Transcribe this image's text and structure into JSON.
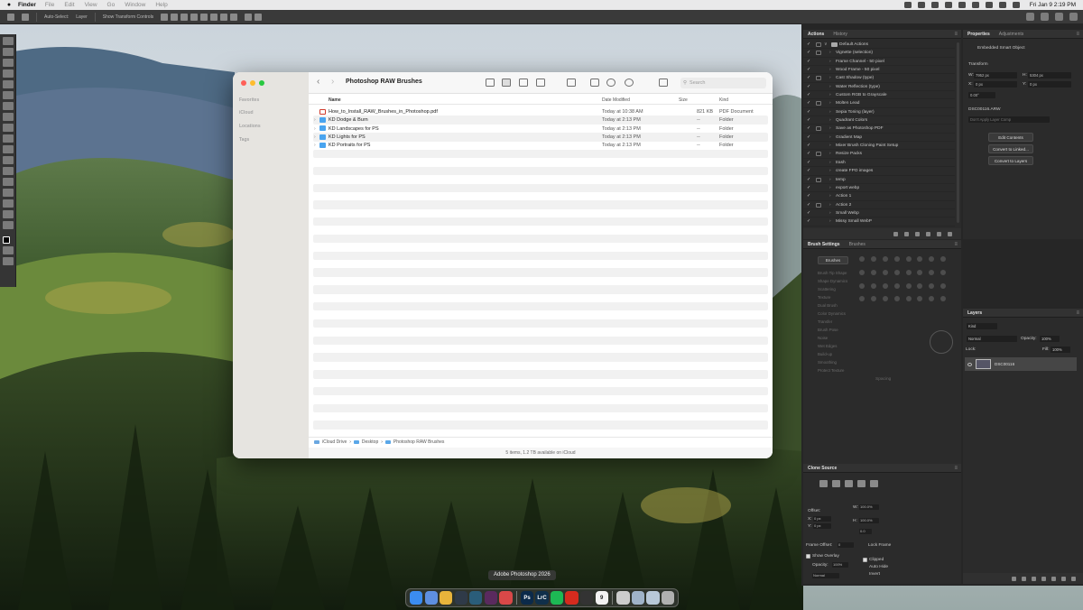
{
  "menubar": {
    "apple": "",
    "app_name": "Finder",
    "items": [
      "File",
      "Edit",
      "View",
      "Go",
      "Window",
      "Help"
    ],
    "clock": "Fri Jan 9  2:19 PM"
  },
  "options_bar": {
    "auto_select": "Auto-Select:",
    "layer_select": "Layer",
    "transform_controls": "Show Transform Controls"
  },
  "finder": {
    "title": "Photoshop RAW Brushes",
    "search_placeholder": "Search",
    "sidebar": {
      "favorites": "Favorites",
      "icloud": "iCloud",
      "locations": "Locations",
      "tags": "Tags"
    },
    "columns": {
      "name": "Name",
      "date": "Date Modified",
      "size": "Size",
      "kind": "Kind"
    },
    "rows": [
      {
        "name": "How_to_Install_RAW_Brushes_in_Photoshop.pdf",
        "date": "Today at 10:38 AM",
        "size": "821 KB",
        "kind": "PDF Document",
        "type": "pdf"
      },
      {
        "name": "KD Dodge & Burn",
        "date": "Today at 2:13 PM",
        "size": "--",
        "kind": "Folder",
        "type": "folder"
      },
      {
        "name": "KD Landscapes for PS",
        "date": "Today at 2:13 PM",
        "size": "--",
        "kind": "Folder",
        "type": "folder"
      },
      {
        "name": "KD Lights for PS",
        "date": "Today at 2:13 PM",
        "size": "--",
        "kind": "Folder",
        "type": "folder"
      },
      {
        "name": "KD Portraits for PS",
        "date": "Today at 2:13 PM",
        "size": "--",
        "kind": "Folder",
        "type": "folder"
      }
    ],
    "path": [
      "iCloud Drive",
      "Desktop",
      "Photoshop RAW Brushes"
    ],
    "status": "5 items, 1.2 TB available on iCloud"
  },
  "actions_panel": {
    "tabs": [
      "Actions",
      "History"
    ],
    "set_name": "Default Actions",
    "items": [
      "Vignette (selection)",
      "Frame Channel - 50 pixel",
      "Wood Frame - 50 pixel",
      "Cast Shadow (type)",
      "Water Reflection (type)",
      "Custom RGB to Grayscale",
      "Molten Lead",
      "Sepia Toning (layer)",
      "Quadrant Colors",
      "Save as Photoshop PDF",
      "Gradient Map",
      "Mixer Brush Cloning Paint Setup",
      "Resize Packs",
      "trash",
      "create FPO images",
      "temp",
      "export webp",
      "Action 1",
      "Action 2",
      "Small Webp",
      "Missy Small WebP"
    ]
  },
  "properties_panel": {
    "tabs": [
      "Properties",
      "Adjustments"
    ],
    "object_type": "Embedded Smart Object",
    "transform_label": "Transform",
    "w_value": "7952 px",
    "h_value": "5304 px",
    "x_value": "0 px",
    "y_value": "0 px",
    "angle_value": "0.00°",
    "file_name": "DSC00116.ARW",
    "layer_comps": "Don't Apply Layer Comp",
    "edit_contents": "Edit Contents",
    "convert_linked": "Convert to Linked...",
    "convert_layers": "Convert to Layers"
  },
  "brush_panel": {
    "tabs": [
      "Brush Settings",
      "Brushes"
    ],
    "brushes_button": "Brushes",
    "options": [
      "Brush Tip Shape",
      "Shape Dynamics",
      "Scattering",
      "Texture",
      "Dual Brush",
      "Color Dynamics",
      "Transfer",
      "Brush Pose",
      "Noise",
      "Wet Edges",
      "Build-up",
      "Smoothing",
      "Protect Texture"
    ],
    "spacing_label": "Spacing"
  },
  "layers_panel": {
    "tab": "Layers",
    "kind": "Kind",
    "blend_mode": "Normal",
    "opacity_label": "Opacity:",
    "opacity_value": "100%",
    "lock_label": "Lock:",
    "fill_label": "Fill:",
    "fill_value": "100%",
    "layer_name": "DSC00116"
  },
  "clone_panel": {
    "tab": "Clone Source",
    "offset_label": "Offset:",
    "x_value": "0 px",
    "y_value": "0 px",
    "w_value": "100.0%",
    "h_value": "100.0%",
    "angle_value": "0.0",
    "frame_offset_label": "Frame Offset:",
    "frame_offset_value": "0",
    "lock_frame": "Lock Frame",
    "show_overlay": "Show Overlay",
    "opacity_label": "Opacity:",
    "opacity_value": "100%",
    "blend": "Normal",
    "clipped": "Clipped",
    "auto_hide": "Auto Hide",
    "invert": "Invert"
  },
  "dock": {
    "tooltip": "Adobe Photoshop 2026",
    "apps": [
      {
        "name": "finder-icon",
        "label": "",
        "color": "#3b8cf0"
      },
      {
        "name": "mail-icon",
        "label": "",
        "color": "#5e8fe0"
      },
      {
        "name": "chrome-icon",
        "label": "",
        "color": "#e8b43b"
      },
      {
        "name": "app-icon-1",
        "label": "",
        "color": "#2f3a48"
      },
      {
        "name": "app-icon-2",
        "label": "",
        "color": "#2a5d7a"
      },
      {
        "name": "slack-icon",
        "label": "",
        "color": "#5a2a5e"
      },
      {
        "name": "app-icon-3",
        "label": "",
        "color": "#d94848"
      },
      {
        "name": "photoshop-icon",
        "label": "Ps",
        "color": "#0b2a4a"
      },
      {
        "name": "lightroom-icon",
        "label": "LrC",
        "color": "#102f4a"
      },
      {
        "name": "spotify-icon",
        "label": "",
        "color": "#1db954"
      },
      {
        "name": "acrobat-icon",
        "label": "",
        "color": "#d52b1e"
      },
      {
        "name": "app-icon-4",
        "label": "",
        "color": "#333333"
      },
      {
        "name": "calendar-icon",
        "label": "9",
        "color": "#f2f2f2"
      },
      {
        "name": "notes-icon",
        "label": "",
        "color": "#cccccc"
      },
      {
        "name": "app-icon-5",
        "label": "",
        "color": "#9fb3c8"
      },
      {
        "name": "app-icon-6",
        "label": "",
        "color": "#b8c8d8"
      },
      {
        "name": "trash-icon",
        "label": "",
        "color": "#b0b0b0"
      }
    ]
  }
}
